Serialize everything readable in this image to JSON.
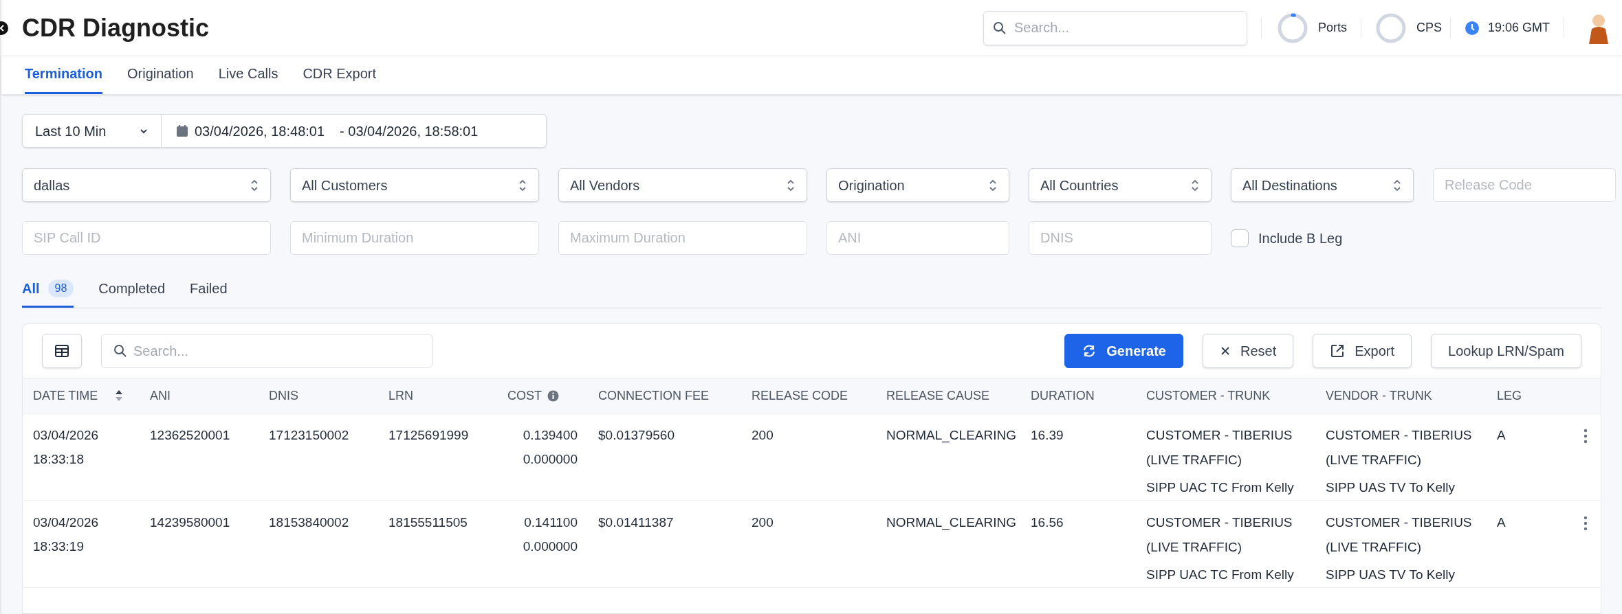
{
  "header": {
    "title": "CDR Diagnostic",
    "search": {
      "placeholder": "Search..."
    },
    "meters": [
      {
        "label": "Ports",
        "level": 0.02
      },
      {
        "label": "CPS"
      }
    ],
    "clock": "19:06 GMT"
  },
  "tabs": [
    {
      "label": "Termination",
      "selected": true
    },
    {
      "label": "Origination",
      "selected": false
    },
    {
      "label": "Live Calls",
      "selected": false
    },
    {
      "label": "CDR Export",
      "selected": false
    }
  ],
  "date_range": {
    "preset": "Last 10 Min",
    "from": "03/04/2026, 18:48:01",
    "to": "- 03/04/2026, 18:58:01"
  },
  "filters": [
    {
      "kind": "select",
      "value": "dallas"
    },
    {
      "kind": "select",
      "value": "All Customers"
    },
    {
      "kind": "select",
      "value": "All Vendors"
    },
    {
      "kind": "select",
      "value": "Origination"
    },
    {
      "kind": "select",
      "value": "All Countries"
    },
    {
      "kind": "select",
      "value": "All Destinations"
    },
    {
      "kind": "input",
      "placeholder": "Release Code"
    },
    {
      "kind": "input",
      "placeholder": "SIP Call ID"
    },
    {
      "kind": "input",
      "placeholder": "Minimum Duration"
    },
    {
      "kind": "input",
      "placeholder": "Maximum Duration"
    },
    {
      "kind": "input",
      "placeholder": "ANI"
    },
    {
      "kind": "input",
      "placeholder": "DNIS"
    },
    {
      "kind": "checkbox",
      "label": "Include B Leg",
      "checked": false
    }
  ],
  "status_tabs": [
    {
      "label": "All",
      "count": "98",
      "selected": true
    },
    {
      "label": "Completed",
      "selected": false
    },
    {
      "label": "Failed",
      "selected": false
    }
  ],
  "toolbar": {
    "search": {
      "placeholder": "Search..."
    },
    "buttons": [
      {
        "kind": "primary",
        "label": "Generate"
      },
      {
        "kind": "default",
        "label": "Reset"
      },
      {
        "kind": "default",
        "label": "Export"
      },
      {
        "kind": "default",
        "label": "Lookup LRN/Spam"
      }
    ]
  },
  "table": {
    "columns": [
      {
        "label": "DATE TIME",
        "sortable": true
      },
      {
        "label": "ANI"
      },
      {
        "label": "DNIS"
      },
      {
        "label": "LRN"
      },
      {
        "label": "COST",
        "info": true
      },
      {
        "label": "CONNECTION FEE"
      },
      {
        "label": "RELEASE CODE"
      },
      {
        "label": "RELEASE CAUSE"
      },
      {
        "label": "DURATION"
      },
      {
        "label": "CUSTOMER - TRUNK"
      },
      {
        "label": "VENDOR - TRUNK"
      },
      {
        "label": "LEG"
      }
    ],
    "rows": [
      {
        "date_time": "03/04/2026 18:33:18",
        "ani": "12362520001",
        "dnis": "17123150002",
        "lrn": "17125691999",
        "cost": [
          "0.139400",
          "0.000000"
        ],
        "connection_fee": "$0.01379560",
        "release_code": "200",
        "release_cause": "NORMAL_CLEARING",
        "duration": "16.39",
        "customer": "CUSTOMER - TIBERIUS (LIVE TRAFFIC)",
        "customer_trunk": "SIPP UAC TC From Kelly",
        "vendor": "CUSTOMER - TIBERIUS (LIVE TRAFFIC)",
        "vendor_trunk": "SIPP UAS TV To Kelly",
        "leg": "A"
      },
      {
        "date_time": "03/04/2026 18:33:19",
        "ani": "14239580001",
        "dnis": "18153840002",
        "lrn": "18155511505",
        "cost": [
          "0.141100",
          "0.000000"
        ],
        "connection_fee": "$0.01411387",
        "release_code": "200",
        "release_cause": "NORMAL_CLEARING",
        "duration": "16.56",
        "customer": "CUSTOMER - TIBERIUS (LIVE TRAFFIC)",
        "customer_trunk": "SIPP UAC TC From Kelly",
        "vendor": "CUSTOMER - TIBERIUS (LIVE TRAFFIC)",
        "vendor_trunk": "SIPP UAS TV To Kelly",
        "leg": "A"
      }
    ]
  }
}
